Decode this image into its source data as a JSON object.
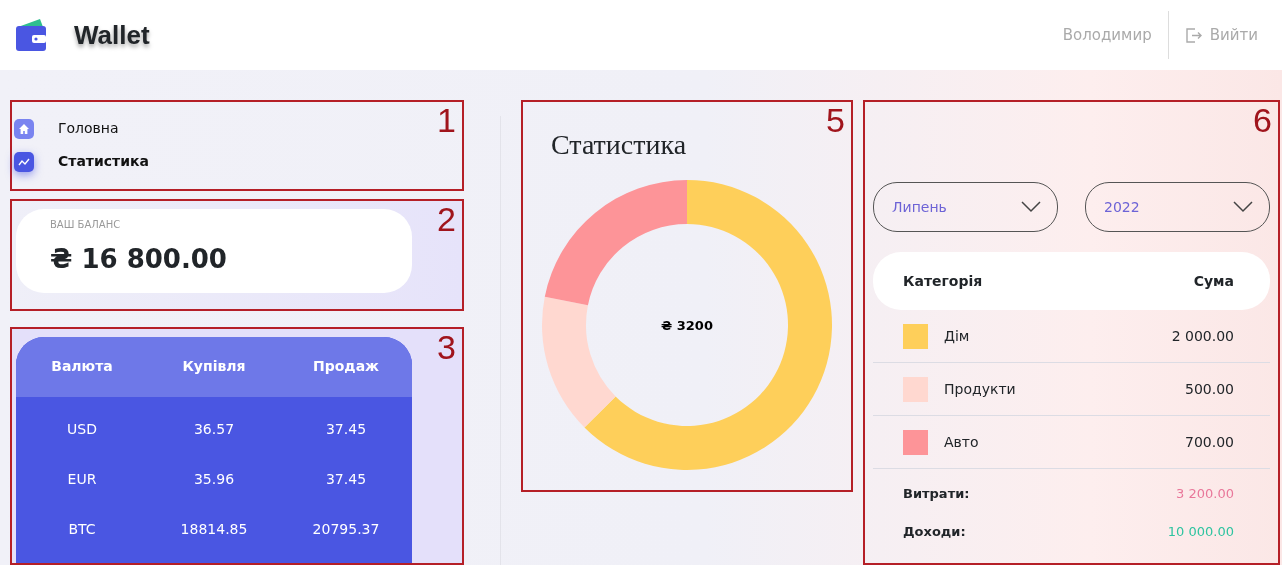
{
  "header": {
    "logo": "Wallet",
    "user": "Володимир",
    "logout": "Вийти"
  },
  "annotations": [
    "1",
    "2",
    "3",
    "5",
    "6"
  ],
  "nav": [
    {
      "label": "Головна",
      "kind": "home",
      "selected": false
    },
    {
      "label": "Статистика",
      "kind": "stats",
      "selected": true
    }
  ],
  "balance": {
    "label": "ВАШ БАЛАНС",
    "amount": "₴ 16 800.00"
  },
  "currency": {
    "columns": [
      "Валюта",
      "Купівля",
      "Продаж"
    ],
    "rows": [
      [
        "USD",
        "36.57",
        "37.45"
      ],
      [
        "EUR",
        "35.96",
        "37.45"
      ],
      [
        "BTC",
        "18814.85",
        "20795.37"
      ]
    ]
  },
  "statistics": {
    "title": "Статистика",
    "total": "₴ 3200"
  },
  "filters": [
    {
      "value": "Липень"
    },
    {
      "value": "2022"
    }
  ],
  "table": {
    "columns": [
      "Категорія",
      "Сума"
    ],
    "rows": [
      {
        "category": "Дім",
        "amount": "2 000.00",
        "color": "#fecf5a"
      },
      {
        "category": "Продукти",
        "amount": "500.00",
        "color": "#ffd8d0"
      },
      {
        "category": "Авто",
        "amount": "700.00",
        "color": "#fd9498"
      }
    ],
    "totals": [
      {
        "label": "Витрати:",
        "value": "3 200.00",
        "kind": "expense"
      },
      {
        "label": "Доходи:",
        "value": "10 000.00",
        "kind": "income"
      }
    ]
  }
}
